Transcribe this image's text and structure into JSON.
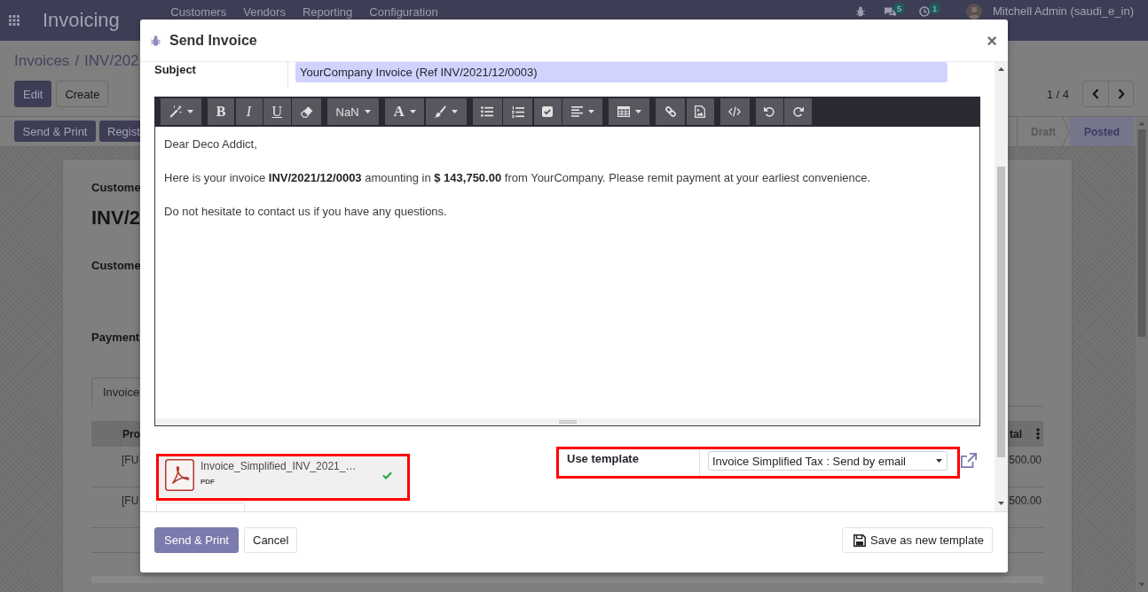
{
  "navbar": {
    "app_title": "Invoicing",
    "menu": [
      "Customers",
      "Vendors",
      "Reporting",
      "Configuration"
    ],
    "chat_count": "5",
    "activity_count": "1",
    "user": "Mitchell Admin (saudi_e_in)"
  },
  "control_panel": {
    "breadcrumb": [
      "Invoices",
      "INV/202"
    ],
    "breadcrumb_separator": "/",
    "buttons": [
      {
        "label": "Edit",
        "kind": "primary"
      },
      {
        "label": "Create",
        "kind": "secondary"
      }
    ],
    "pager": "1 / 4"
  },
  "status_bar": {
    "buttons": [
      "Send & Print",
      "Regist"
    ],
    "stages": [
      {
        "label": "Draft",
        "selected": false
      },
      {
        "label": "Posted",
        "selected": true
      }
    ]
  },
  "sheet": {
    "subtitle": "Custome",
    "name": "INV/2",
    "fields": [
      "Custome",
      "Payment"
    ],
    "tabs": [
      {
        "label": "Invoice",
        "selected": true
      }
    ],
    "table": {
      "columns": [
        "Pro",
        "tal"
      ],
      "rows": [
        [
          "[FU",
          "500.00"
        ],
        [
          "[FU",
          "500.00"
        ]
      ]
    }
  },
  "dialog": {
    "title": "Send Invoice",
    "close": "×",
    "subject": {
      "label": "Subject",
      "value": "YourCompany Invoice (Ref INV/2021/12/0003)"
    },
    "toolbar": [
      [
        {
          "kind": "magic",
          "dropdown": true
        }
      ],
      [
        {
          "kind": "bold",
          "label": "B",
          "dropdown": false
        },
        {
          "kind": "italic",
          "label": "I",
          "dropdown": false
        },
        {
          "kind": "underline",
          "label": "U",
          "dropdown": false
        },
        {
          "kind": "eraser",
          "dropdown": false
        }
      ],
      [
        {
          "kind": "font-size",
          "label": "NaN",
          "dropdown": true
        }
      ],
      [
        {
          "kind": "font-color",
          "label": "A",
          "dropdown": true
        },
        {
          "kind": "brush",
          "dropdown": true
        }
      ],
      [
        {
          "kind": "bullets",
          "dropdown": false
        },
        {
          "kind": "numbers",
          "dropdown": false
        },
        {
          "kind": "checklist",
          "dropdown": false
        },
        {
          "kind": "align",
          "dropdown": true
        }
      ],
      [
        {
          "kind": "table",
          "dropdown": true
        }
      ],
      [
        {
          "kind": "link",
          "dropdown": false
        },
        {
          "kind": "image",
          "dropdown": false
        }
      ],
      [
        {
          "kind": "code",
          "dropdown": false
        }
      ],
      [
        {
          "kind": "undo",
          "dropdown": false
        },
        {
          "kind": "redo",
          "dropdown": false
        }
      ]
    ],
    "body": [
      "Dear Deco Addict,",
      "Here is your invoice **INV/2021/12/0003** amounting in **$ 143,750.00** from YourCompany. Please remit payment at your earliest convenience.",
      "Do not hesitate to contact us if you have any questions."
    ],
    "attachments": [
      {
        "name": "Invoice_Simplified_INV_2021_…",
        "type": "PDF",
        "uploaded": true,
        "highlighted": true
      }
    ],
    "template": {
      "label": "Use template",
      "value": "Invoice Simplified Tax : Send by email",
      "highlighted": true
    },
    "buttons": [
      {
        "label": "Send & Print",
        "kind": "primary"
      },
      {
        "label": "Cancel",
        "kind": "secondary"
      }
    ],
    "save_template": "Save as new template"
  }
}
